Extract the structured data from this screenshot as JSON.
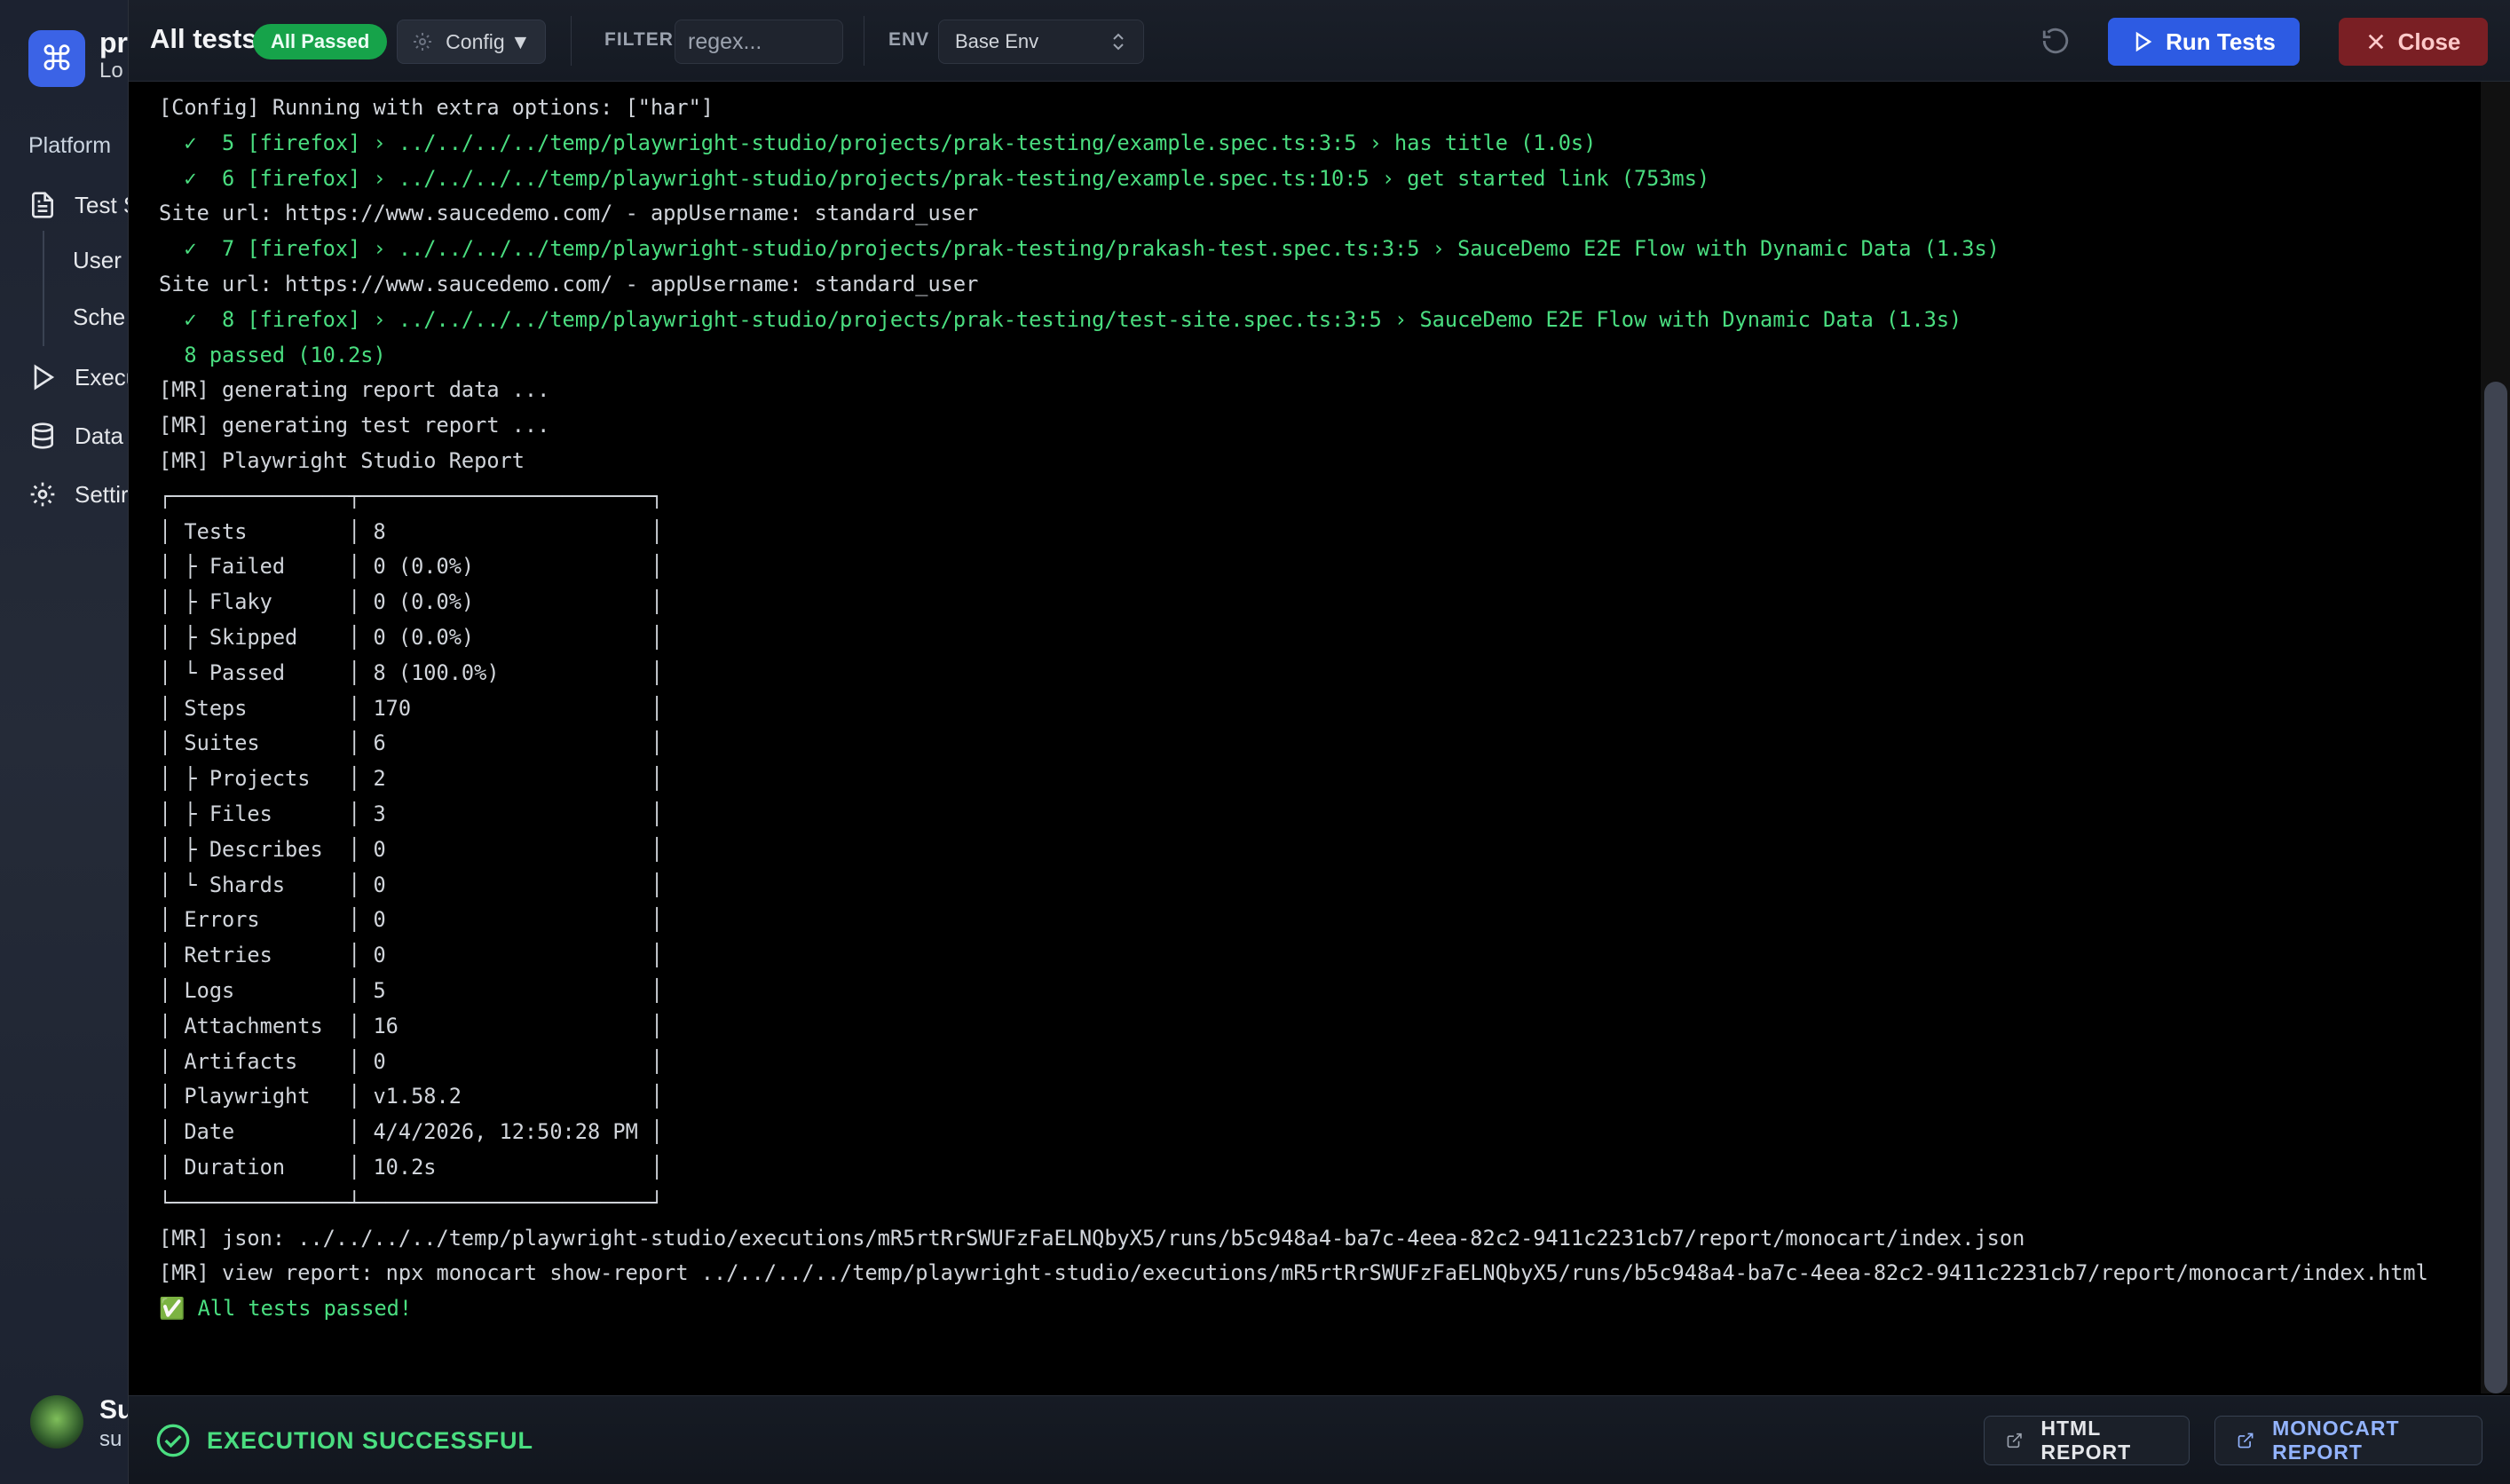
{
  "sidebar": {
    "app_name": "pr",
    "app_sub": "Lo",
    "section": "Platform",
    "items": [
      {
        "label": "Test S",
        "icon": "file-text-icon"
      },
      {
        "label": "User",
        "icon": ""
      },
      {
        "label": "Sche",
        "icon": ""
      },
      {
        "label": "Execu",
        "icon": "play-icon"
      },
      {
        "label": "Data",
        "icon": "database-icon"
      },
      {
        "label": "Settir",
        "icon": "gear-icon"
      }
    ],
    "user_name": "Su",
    "user_mail": "su"
  },
  "header": {
    "title": "All tests",
    "badge": "All Passed",
    "config_label": "Config ▼",
    "filter_label": "FILTER",
    "filter_placeholder": "regex...",
    "env_label": "ENV",
    "env_value": "Base Env",
    "run_label": "Run Tests",
    "close_label": "Close"
  },
  "terminal": {
    "lines": [
      {
        "text": "[Config] Running with extra options: [\"har\"]",
        "ok": false
      },
      {
        "text": "  ✓  5 [firefox] › ../../../../temp/playwright-studio/projects/prak-testing/example.spec.ts:3:5 › has title (1.0s)",
        "ok": true
      },
      {
        "text": "  ✓  6 [firefox] › ../../../../temp/playwright-studio/projects/prak-testing/example.spec.ts:10:5 › get started link (753ms)",
        "ok": true
      },
      {
        "text": "Site url: https://www.saucedemo.com/ - appUsername: standard_user",
        "ok": false
      },
      {
        "text": "  ✓  7 [firefox] › ../../../../temp/playwright-studio/projects/prak-testing/prakash-test.spec.ts:3:5 › SauceDemo E2E Flow with Dynamic Data (1.3s)",
        "ok": true
      },
      {
        "text": "Site url: https://www.saucedemo.com/ - appUsername: standard_user",
        "ok": false
      },
      {
        "text": "  ✓  8 [firefox] › ../../../../temp/playwright-studio/projects/prak-testing/test-site.spec.ts:3:5 › SauceDemo E2E Flow with Dynamic Data (1.3s)",
        "ok": true
      },
      {
        "text": "  8 passed (10.2s)",
        "ok": true
      },
      {
        "text": "[MR] generating report data ...",
        "ok": false
      },
      {
        "text": "[MR] generating test report ...",
        "ok": false
      },
      {
        "text": "[MR] Playwright Studio Report",
        "ok": false
      },
      {
        "text": "┌──────────────┬───────────────────────┐",
        "ok": false
      },
      {
        "text": "│ Tests        │ 8                     │",
        "ok": false
      },
      {
        "text": "│ ├ Failed     │ 0 (0.0%)              │",
        "ok": false
      },
      {
        "text": "│ ├ Flaky      │ 0 (0.0%)              │",
        "ok": false
      },
      {
        "text": "│ ├ Skipped    │ 0 (0.0%)              │",
        "ok": false
      },
      {
        "text": "│ └ Passed     │ 8 (100.0%)            │",
        "ok": false
      },
      {
        "text": "│ Steps        │ 170                   │",
        "ok": false
      },
      {
        "text": "│ Suites       │ 6                     │",
        "ok": false
      },
      {
        "text": "│ ├ Projects   │ 2                     │",
        "ok": false
      },
      {
        "text": "│ ├ Files      │ 3                     │",
        "ok": false
      },
      {
        "text": "│ ├ Describes  │ 0                     │",
        "ok": false
      },
      {
        "text": "│ └ Shards     │ 0                     │",
        "ok": false
      },
      {
        "text": "│ Errors       │ 0                     │",
        "ok": false
      },
      {
        "text": "│ Retries      │ 0                     │",
        "ok": false
      },
      {
        "text": "│ Logs         │ 5                     │",
        "ok": false
      },
      {
        "text": "│ Attachments  │ 16                    │",
        "ok": false
      },
      {
        "text": "│ Artifacts    │ 0                     │",
        "ok": false
      },
      {
        "text": "│ Playwright   │ v1.58.2               │",
        "ok": false
      },
      {
        "text": "│ Date         │ 4/4/2026, 12:50:28 PM │",
        "ok": false
      },
      {
        "text": "│ Duration     │ 10.2s                 │",
        "ok": false
      },
      {
        "text": "└──────────────┴───────────────────────┘",
        "ok": false
      },
      {
        "text": "[MR] json: ../../../../temp/playwright-studio/executions/mR5rtRrSWUFzFaELNQbyX5/runs/b5c948a4-ba7c-4eea-82c2-9411c2231cb7/report/monocart/index.json",
        "ok": false
      },
      {
        "text": "[MR] view report: npx monocart show-report ../../../../temp/playwright-studio/executions/mR5rtRrSWUFzFaELNQbyX5/runs/b5c948a4-ba7c-4eea-82c2-9411c2231cb7/report/monocart/index.html",
        "ok": false
      },
      {
        "text": "✅ All tests passed!",
        "ok": true
      }
    ]
  },
  "footer": {
    "status": "EXECUTION SUCCESSFUL",
    "html_report": "HTML REPORT",
    "monocart_report": "MONOCART REPORT"
  },
  "colors": {
    "accent": "#2d5be3",
    "success": "#4ade80",
    "danger": "#7a1f24"
  }
}
